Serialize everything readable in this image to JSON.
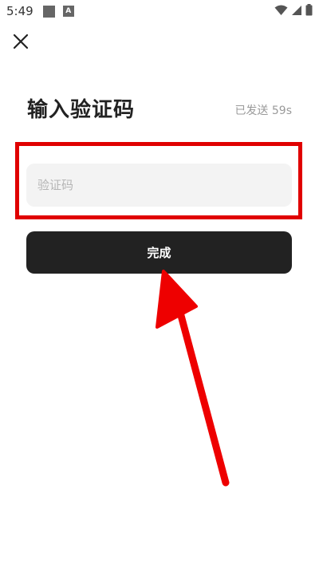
{
  "status_bar": {
    "time": "5:49",
    "notification_badge": "A"
  },
  "header": {
    "close_icon": "close-icon"
  },
  "main": {
    "title": "输入验证码",
    "sent_status": "已发送 59s",
    "code_input": {
      "value": "",
      "placeholder": "验证码"
    },
    "done_label": "完成"
  },
  "annotations": {
    "highlight_color": "#e00000"
  },
  "colors": {
    "button_bg": "#222222",
    "input_bg": "#f3f3f3",
    "muted_text": "#9a9a9a"
  }
}
